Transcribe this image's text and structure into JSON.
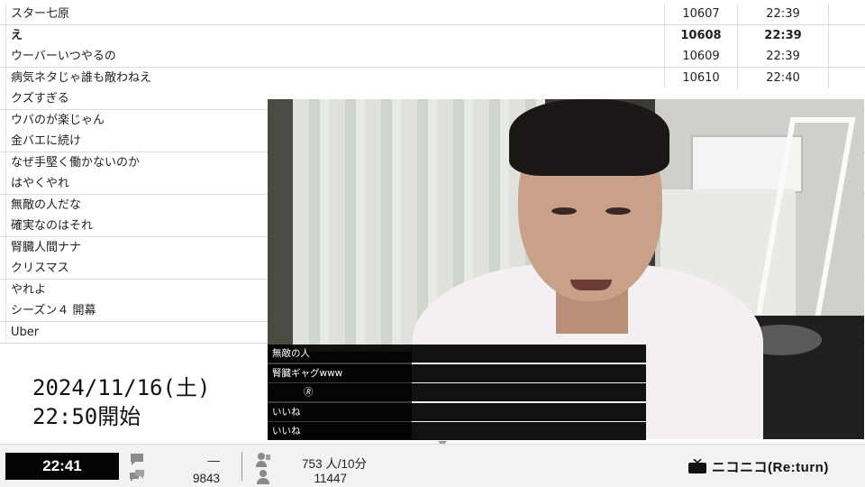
{
  "comments": [
    {
      "text": "スター七原",
      "no": "10607",
      "time": "22:39",
      "bold": false
    },
    {
      "text": "え",
      "no": "10608",
      "time": "22:39",
      "bold": true
    },
    {
      "text": "ウーバーいつやるの",
      "no": "10609",
      "time": "22:39",
      "bold": false
    },
    {
      "text": "病気ネタじゃ誰も敵わねえ",
      "no": "10610",
      "time": "22:40",
      "bold": false
    },
    {
      "text": "クズすぎる"
    },
    {
      "text": "ウバのが楽じゃん"
    },
    {
      "text": "金バエに続け"
    },
    {
      "text": "なぜ手堅く働かないのか"
    },
    {
      "text": "はやくやれ"
    },
    {
      "text": "無敵の人だな"
    },
    {
      "text": "確実なのはそれ"
    },
    {
      "text": "腎臓人間ナナ"
    },
    {
      "text": "クリスマス"
    },
    {
      "text": "やれよ"
    },
    {
      "text": "シーズン４ 開幕"
    },
    {
      "text": "Uber"
    }
  ],
  "overlay": [
    "無敵の人",
    "腎臓ギャグwww",
    "🄬",
    "いいね",
    "いいね"
  ],
  "date": {
    "line1": "2024/11/16(土)",
    "line2": "22:50開始"
  },
  "status": {
    "clock": "22:41",
    "comment_rate": "—",
    "comment_total": "9843",
    "viewer_rate": "753 人/10分",
    "viewer_total": "11447"
  },
  "logo": {
    "text": "ニコニコ(Re:turn)"
  }
}
